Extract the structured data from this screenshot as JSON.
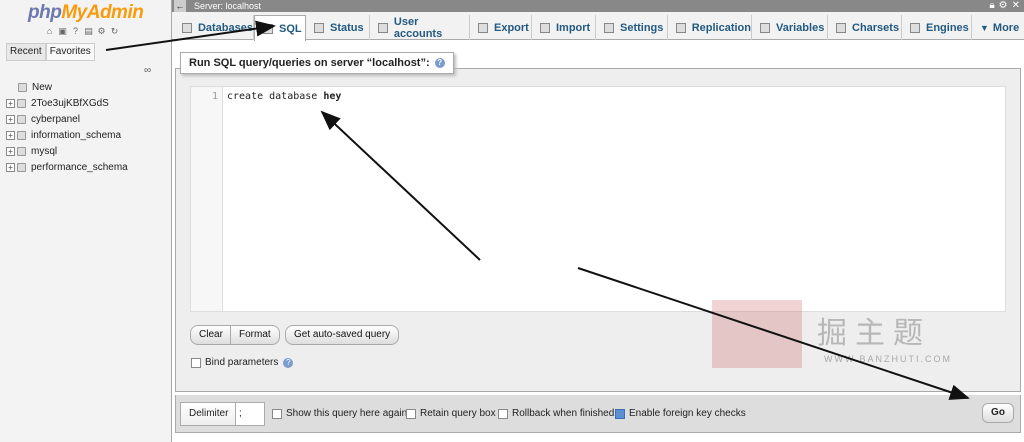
{
  "logo": {
    "php": "php",
    "myadmin": "MyAdmin"
  },
  "nav_tabs": {
    "recent": "Recent",
    "favorites": "Favorites"
  },
  "tree": {
    "new_label": "New",
    "databases": [
      "2Toe3ujKBfXGdS",
      "cyberpanel",
      "information_schema",
      "mysql",
      "performance_schema"
    ]
  },
  "topbar": {
    "server": "Server: localhost"
  },
  "menu": {
    "databases": "Databases",
    "sql": "SQL",
    "status": "Status",
    "users": "User accounts",
    "export": "Export",
    "import": "Import",
    "settings": "Settings",
    "replication": "Replication",
    "variables": "Variables",
    "charsets": "Charsets",
    "engines": "Engines",
    "more": "More"
  },
  "sql": {
    "legend": "Run SQL query/queries on server “localhost”:",
    "line_number": "1",
    "code_prefix": "create database ",
    "code_name": "hey",
    "clear": "Clear",
    "format": "Format",
    "autosaved": "Get auto-saved query",
    "bind": "Bind parameters"
  },
  "bottom": {
    "delimiter_label": "Delimiter",
    "delimiter_value": ";",
    "show_again": "Show this query here again",
    "retain": "Retain query box",
    "rollback": "Rollback when finished",
    "foreign": "Enable foreign key checks",
    "go": "Go"
  },
  "watermark": {
    "cn": "掘主题",
    "site": "WWW.BANZHUTI.COM"
  }
}
